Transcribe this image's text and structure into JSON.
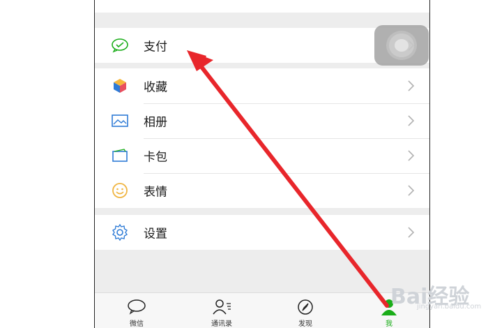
{
  "menu": {
    "groups": [
      {
        "items": [
          {
            "label": "支付",
            "icon": "wechat-pay-icon",
            "color": "#1aad19"
          }
        ]
      },
      {
        "items": [
          {
            "label": "收藏",
            "icon": "favorites-cube-icon",
            "color": "#f6b73c"
          },
          {
            "label": "相册",
            "icon": "album-image-icon",
            "color": "#2e7bd6"
          },
          {
            "label": "卡包",
            "icon": "card-wallet-icon",
            "color": "#2e7bd6"
          },
          {
            "label": "表情",
            "icon": "emoji-face-icon",
            "color": "#f0b541"
          }
        ]
      },
      {
        "items": [
          {
            "label": "设置",
            "icon": "settings-gear-icon",
            "color": "#2e7bd6"
          }
        ]
      }
    ]
  },
  "tabbar": {
    "tabs": [
      {
        "label": "微信",
        "icon": "chat-bubble-icon",
        "active": false
      },
      {
        "label": "通讯录",
        "icon": "contacts-icon",
        "active": false
      },
      {
        "label": "发现",
        "icon": "compass-icon",
        "active": false
      },
      {
        "label": "我",
        "icon": "me-person-icon",
        "active": true
      }
    ]
  },
  "watermark": {
    "brand": "Bai经验",
    "url": "jingyan.baidu.com"
  },
  "colors": {
    "accent": "#1aad19",
    "arrow": "#e8262b",
    "background": "#ededed"
  }
}
